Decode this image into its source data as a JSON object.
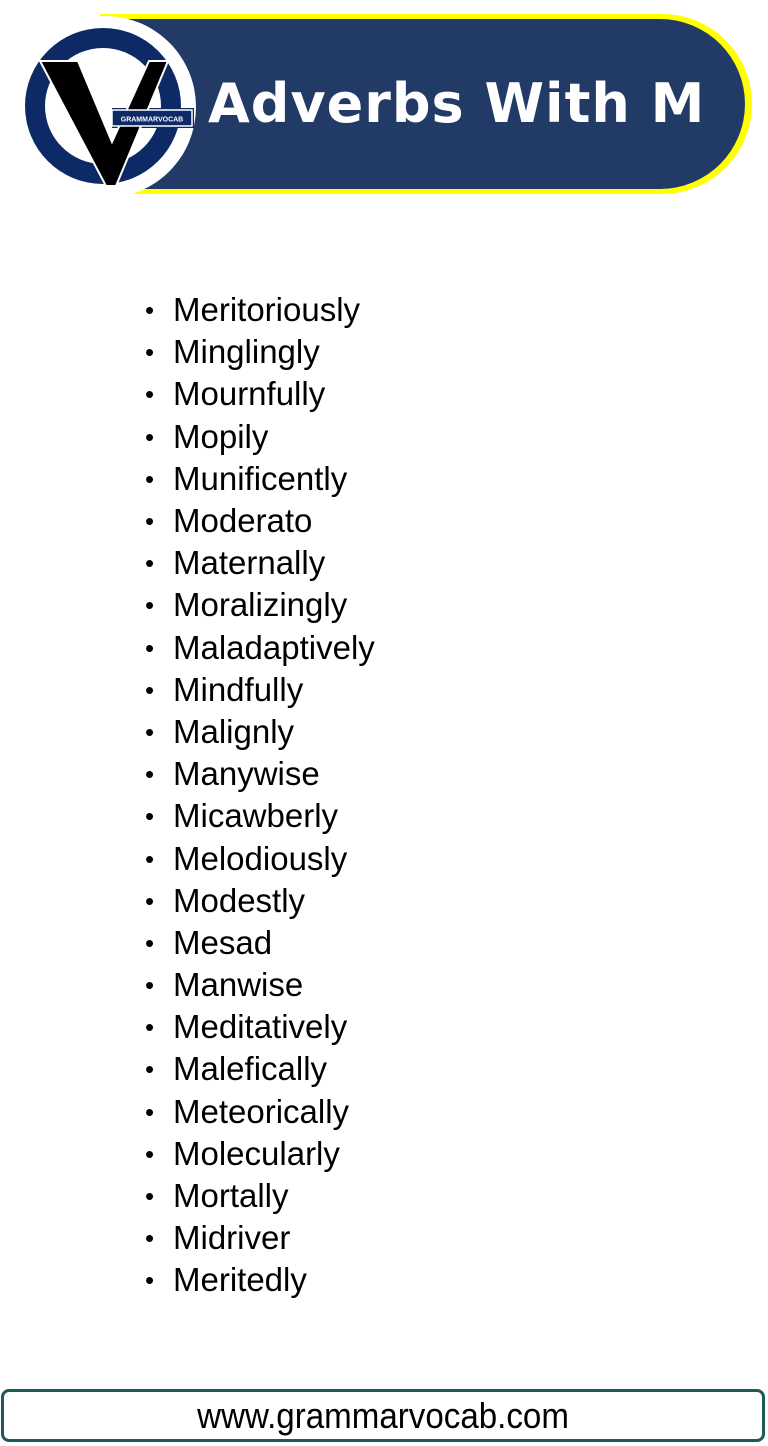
{
  "header": {
    "title": "Adverbs With M",
    "logo": {
      "icon": "grammarvocab-logo-icon",
      "text": "GRAMMARVOCAB"
    },
    "colors": {
      "banner": "#223a66",
      "banner_border": "#ffff00",
      "logo_ring": "#0e2a66",
      "logo_v": "#000000",
      "title_text": "#ffffff"
    }
  },
  "list": {
    "bullet": "•",
    "items": [
      "Meritoriously",
      "Minglingly",
      "Mournfully",
      "Mopily",
      "Munificently",
      "Moderato",
      "Maternally",
      "Moralizingly",
      "Maladaptively",
      "Mindfully",
      "Malignly",
      "Manywise",
      "Micawberly",
      "Melodiously",
      "Modestly",
      "Mesad",
      "Manwise",
      "Meditatively",
      "Malefically",
      "Meteorically",
      "Molecularly",
      "Mortally",
      "Midriver",
      "Meritedly"
    ]
  },
  "footer": {
    "url": "www.grammarvocab.com",
    "border_color": "#1d5a58"
  }
}
